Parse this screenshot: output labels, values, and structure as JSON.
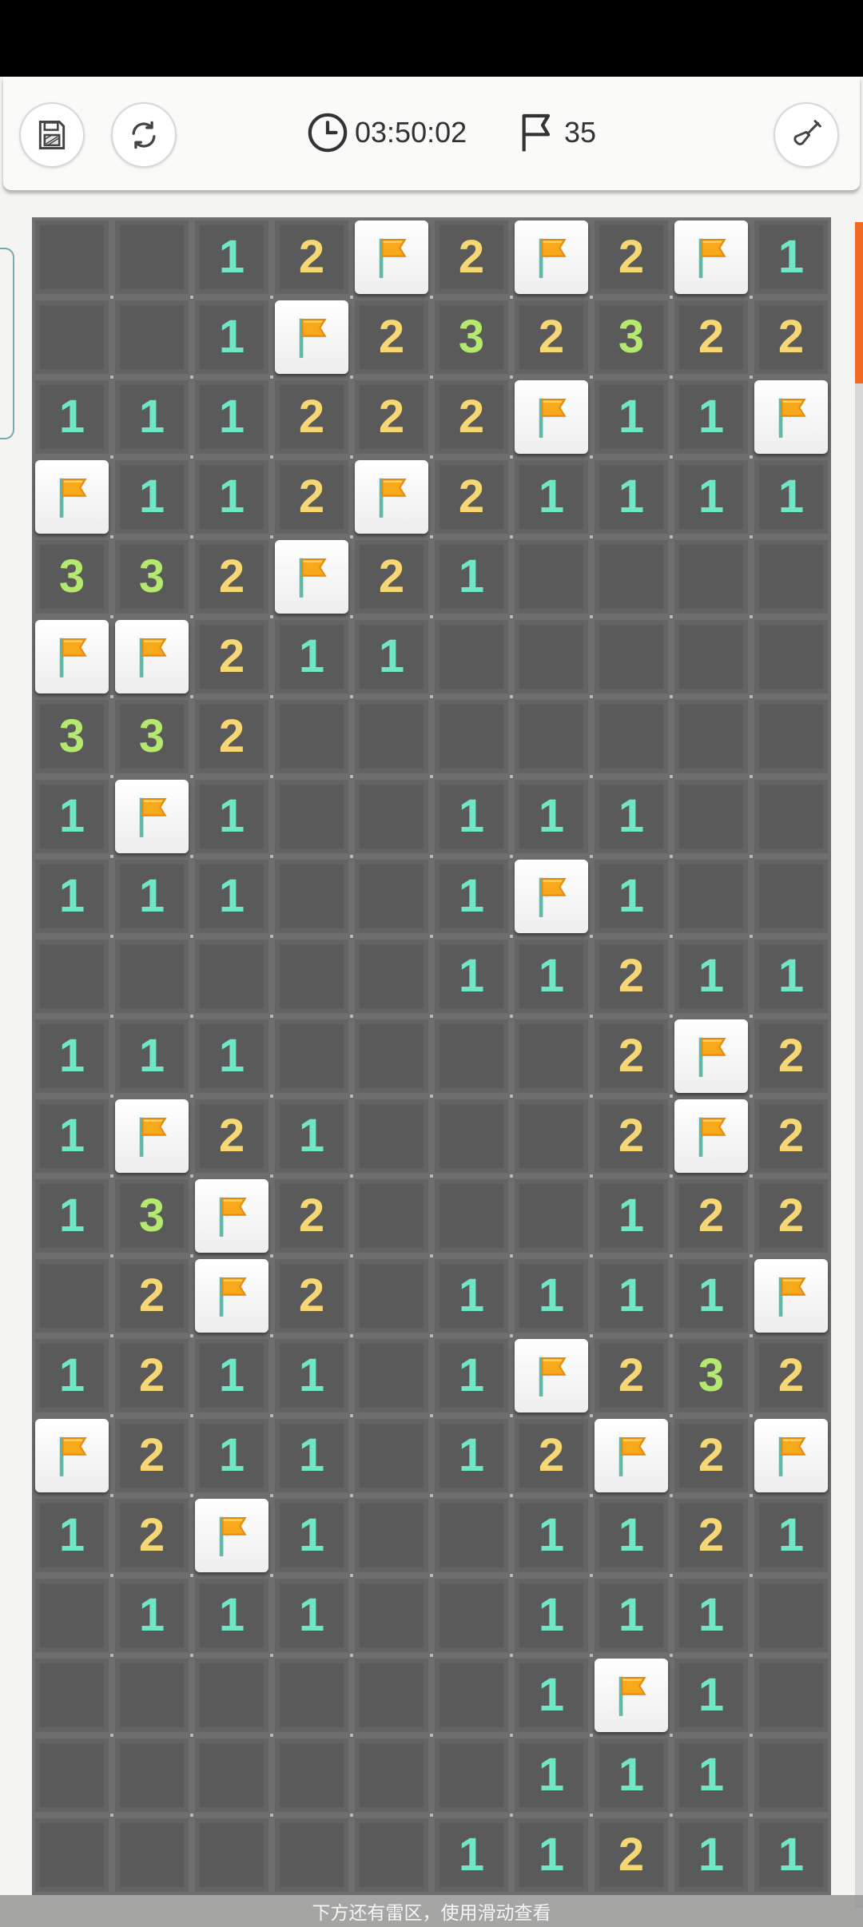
{
  "toolbar": {
    "save_icon": "save-icon",
    "restart_icon": "refresh-icon",
    "timer": "03:50:02",
    "flags_remaining": "35",
    "tool_icon": "shovel-icon"
  },
  "board": {
    "cols": 10,
    "rows": 21,
    "colors": {
      "1": "#6fe6c6",
      "2": "#f6d774",
      "3": "#b4e86e"
    },
    "grid": [
      ". . 1 2 F 2 F 2 F 1",
      ". . 1 F 2 3 2 3 2 2",
      "1 1 1 2 2 2 F 1 1 F",
      "F 1 1 2 F 2 1 1 1 1",
      "3 3 2 F 2 1 . . . .",
      "F F 2 1 1 . . . . .",
      "3 3 2 . . . . . . .",
      "1 F 1 . . 1 1 1 . .",
      "1 1 1 . . 1 F 1 . .",
      ". . . . . 1 1 2 1 1",
      "1 1 1 . . . . 2 F 2",
      "1 F 2 1 . . . 2 F 2",
      "1 3 F 2 . . . 1 2 2",
      ". 2 F 2 . 1 1 1 1 F",
      "1 2 1 1 . 1 F 2 3 2",
      "F 2 1 1 . 1 2 F 2 F",
      "1 2 F 1 . . 1 1 2 1",
      ". 1 1 1 . . 1 1 1 .",
      ". . . . . . 1 F 1 .",
      ". . . . . . 1 1 1 .",
      ". . . . . 1 1 2 1 1"
    ]
  },
  "hint": "下方还有雷区，使用滑动查看"
}
